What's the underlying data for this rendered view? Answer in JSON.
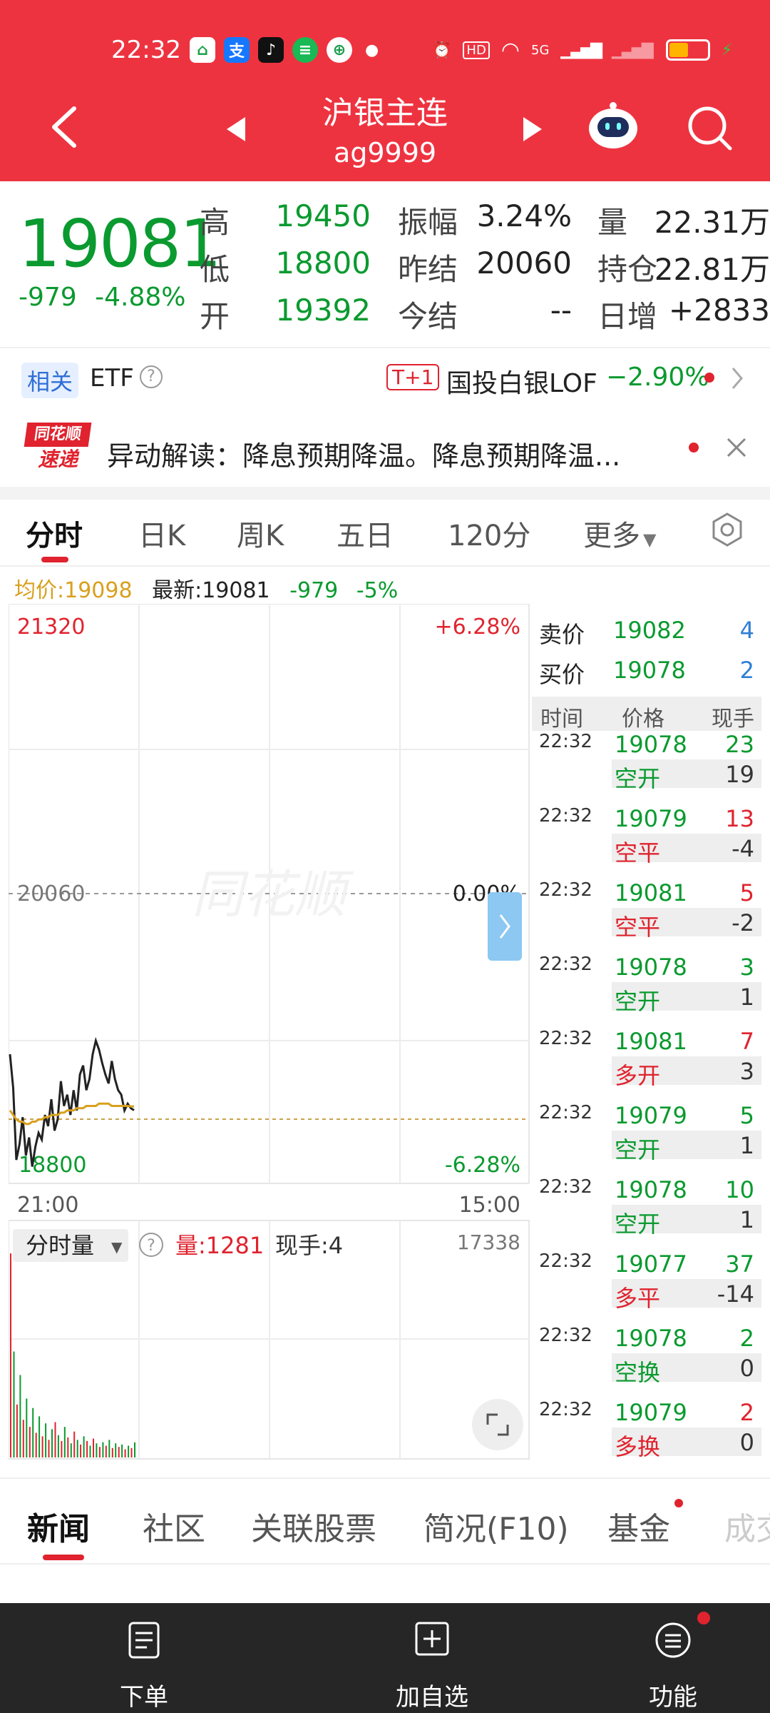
{
  "status_bar": {
    "time": "22:32",
    "network": "5G",
    "hd": "HD"
  },
  "header": {
    "title": "沪银主连",
    "subtitle": "ag9999"
  },
  "quote": {
    "price": "19081",
    "change": "-979",
    "change_pct": "-4.88%",
    "stats": [
      {
        "label": "高",
        "value": "19450",
        "color": "green"
      },
      {
        "label": "低",
        "value": "18800",
        "color": "green"
      },
      {
        "label": "开",
        "value": "19392",
        "color": "green"
      },
      {
        "label": "振幅",
        "value": "3.24%",
        "color": "dark"
      },
      {
        "label": "昨结",
        "value": "20060",
        "color": "dark"
      },
      {
        "label": "今结",
        "value": "--",
        "color": "dark"
      },
      {
        "label": "量",
        "value": "22.31万",
        "color": "dark"
      },
      {
        "label": "持仓",
        "value": "22.81万",
        "color": "dark"
      },
      {
        "label": "日增",
        "value": "+2833",
        "color": "dark"
      }
    ]
  },
  "etf": {
    "tag": "相关",
    "label": "ETF",
    "badge": "T+1",
    "name": "国投白银LOF",
    "pct": "−2.90%"
  },
  "news_flash": {
    "logo_top": "同花顺",
    "logo_bottom": "速递",
    "text": "异动解读：降息预期降温。降息预期降温..."
  },
  "tabs": [
    "分时",
    "日K",
    "周K",
    "五日",
    "120分",
    "更多"
  ],
  "chart_info": {
    "avg_label": "均价:19098",
    "latest_label": "最新:19081",
    "chg": "-979",
    "pct": "-5%"
  },
  "chart": {
    "top_price": "21320",
    "top_pct": "+6.28%",
    "mid_price": "20060",
    "mid_pct": "0.00%",
    "bottom_price": "18800",
    "bottom_pct": "-6.28%",
    "start_time": "21:00",
    "end_time": "15:00",
    "volume_selector": "分时量",
    "volume_label": "量:1281",
    "hand_label": "现手:4",
    "volume_max": "17338",
    "watermark": "同花顺"
  },
  "chart_data": {
    "type": "line",
    "x": [
      0,
      1,
      2,
      3,
      4,
      5,
      6,
      7,
      8,
      9,
      10,
      11,
      12,
      13,
      14,
      15,
      16,
      17,
      18,
      19,
      20,
      21,
      22,
      23,
      24,
      25,
      26,
      27,
      28,
      29,
      30,
      31,
      32,
      33,
      34,
      35,
      36,
      37,
      38,
      39
    ],
    "series": [
      {
        "values": [
          19330,
          19180,
          18860,
          18930,
          19050,
          18880,
          18960,
          18830,
          18920,
          18980,
          18950,
          19060,
          19010,
          19130,
          18990,
          19040,
          19210,
          19100,
          19150,
          19060,
          19170,
          19080,
          19240,
          19280,
          19170,
          19220,
          19330,
          19390,
          19350,
          19290,
          19240,
          19200,
          19300,
          19220,
          19170,
          19150,
          19080,
          19110,
          19090,
          19081
        ]
      },
      {
        "values": [
          19080,
          19060,
          19040,
          19030,
          19030,
          19020,
          19020,
          19030,
          19030,
          19040,
          19040,
          19050,
          19050,
          19060,
          19060,
          19060,
          19070,
          19070,
          19080,
          19080,
          19080,
          19090,
          19090,
          19090,
          19100,
          19100,
          19100,
          19100,
          19110,
          19110,
          19110,
          19110,
          19100,
          19100,
          19100,
          19100,
          19100,
          19100,
          19098,
          19098
        ]
      }
    ],
    "volume": [
      17338,
      9000,
      4500,
      7000,
      3200,
      5000,
      2600,
      4200,
      2100,
      3500,
      1800,
      2900,
      1500,
      2400,
      3000,
      1900,
      1400,
      2600,
      1700,
      1200,
      2200,
      1500,
      1100,
      1800,
      1400,
      1000,
      1600,
      1200,
      900,
      1300,
      1000,
      1500,
      800,
      1200,
      900,
      1100,
      700,
      1000,
      800,
      1281
    ],
    "ylim": [
      18800,
      21320
    ]
  },
  "order_book": {
    "sell_label": "卖价",
    "sell_price": "19082",
    "sell_qty": "4",
    "buy_label": "买价",
    "buy_price": "19078",
    "buy_qty": "2"
  },
  "trades_header": [
    "时间",
    "价格",
    "现手"
  ],
  "trades": [
    {
      "time": "22:32",
      "price": "19078",
      "qty": "23",
      "kind": "空开",
      "delta": "19",
      "qty_color": "green",
      "kind_color": "green"
    },
    {
      "time": "22:32",
      "price": "19079",
      "qty": "13",
      "kind": "空平",
      "delta": "-4",
      "qty_color": "red",
      "kind_color": "red"
    },
    {
      "time": "22:32",
      "price": "19081",
      "qty": "5",
      "kind": "空平",
      "delta": "-2",
      "qty_color": "red",
      "kind_color": "red"
    },
    {
      "time": "22:32",
      "price": "19078",
      "qty": "3",
      "kind": "空开",
      "delta": "1",
      "qty_color": "green",
      "kind_color": "green"
    },
    {
      "time": "22:32",
      "price": "19081",
      "qty": "7",
      "kind": "多开",
      "delta": "3",
      "qty_color": "red",
      "kind_color": "red"
    },
    {
      "time": "22:32",
      "price": "19079",
      "qty": "5",
      "kind": "空开",
      "delta": "1",
      "qty_color": "green",
      "kind_color": "green"
    },
    {
      "time": "22:32",
      "price": "19078",
      "qty": "10",
      "kind": "空开",
      "delta": "1",
      "qty_color": "green",
      "kind_color": "green"
    },
    {
      "time": "22:32",
      "price": "19077",
      "qty": "37",
      "kind": "多平",
      "delta": "-14",
      "qty_color": "green",
      "kind_color": "red"
    },
    {
      "time": "22:32",
      "price": "19078",
      "qty": "2",
      "kind": "空换",
      "delta": "0",
      "qty_color": "green",
      "kind_color": "green"
    },
    {
      "time": "22:32",
      "price": "19079",
      "qty": "2",
      "kind": "多换",
      "delta": "0",
      "qty_color": "red",
      "kind_color": "red"
    }
  ],
  "bottom_tabs": [
    "新闻",
    "社区",
    "关联股票",
    "简况(F10)",
    "基金",
    "成交"
  ],
  "footer": [
    "下单",
    "加自选",
    "功能"
  ],
  "colors": {
    "header_red": "#ee3340",
    "up_red": "#e0232e",
    "down_green": "#0a9a2f",
    "avg_line": "#d9a01e",
    "footer_bg": "#262626"
  }
}
